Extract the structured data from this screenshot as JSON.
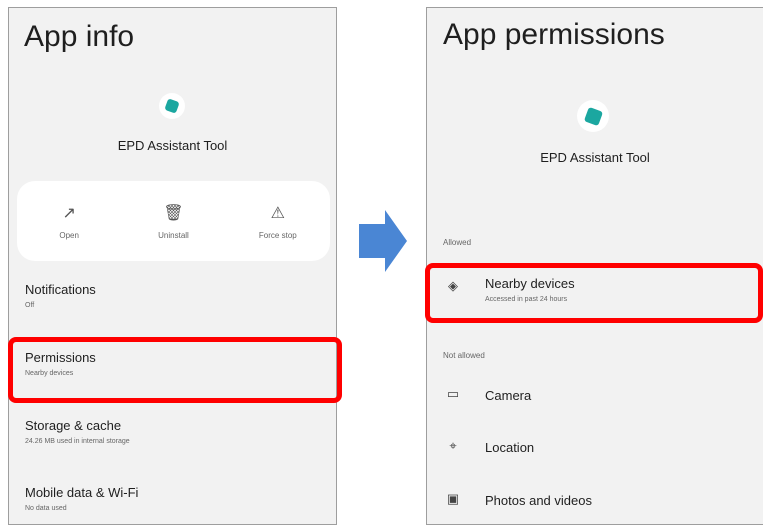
{
  "left_screen": {
    "title": "App info",
    "app_name": "EPD Assistant Tool",
    "actions": [
      {
        "icon": "open-icon",
        "glyph": "↗",
        "label": "Open"
      },
      {
        "icon": "trash-icon",
        "glyph": "🗑",
        "label": "Uninstall"
      },
      {
        "icon": "warning-icon",
        "glyph": "⚠",
        "label": "Force stop"
      }
    ],
    "rows": [
      {
        "title": "Notifications",
        "subtitle": "Off"
      },
      {
        "title": "Permissions",
        "subtitle": "Nearby devices"
      },
      {
        "title": "Storage & cache",
        "subtitle": "24.26 MB used in internal storage"
      },
      {
        "title": "Mobile data & Wi-Fi",
        "subtitle": "No data used"
      }
    ]
  },
  "right_screen": {
    "title": "App permissions",
    "app_name": "EPD Assistant Tool",
    "allowed_label": "Allowed",
    "not_allowed_label": "Not allowed",
    "allowed": [
      {
        "icon": "nearby-devices-icon",
        "glyph": "◈",
        "title": "Nearby devices",
        "subtitle": "Accessed in past 24 hours"
      }
    ],
    "not_allowed": [
      {
        "icon": "camera-icon",
        "glyph": "▭",
        "title": "Camera"
      },
      {
        "icon": "location-icon",
        "glyph": "⌖",
        "title": "Location"
      },
      {
        "icon": "photos-icon",
        "glyph": "▣",
        "title": "Photos and videos"
      }
    ]
  },
  "colors": {
    "highlight": "#ff0000",
    "arrow": "#4a86d4",
    "app_icon": "#1ba7a0"
  }
}
